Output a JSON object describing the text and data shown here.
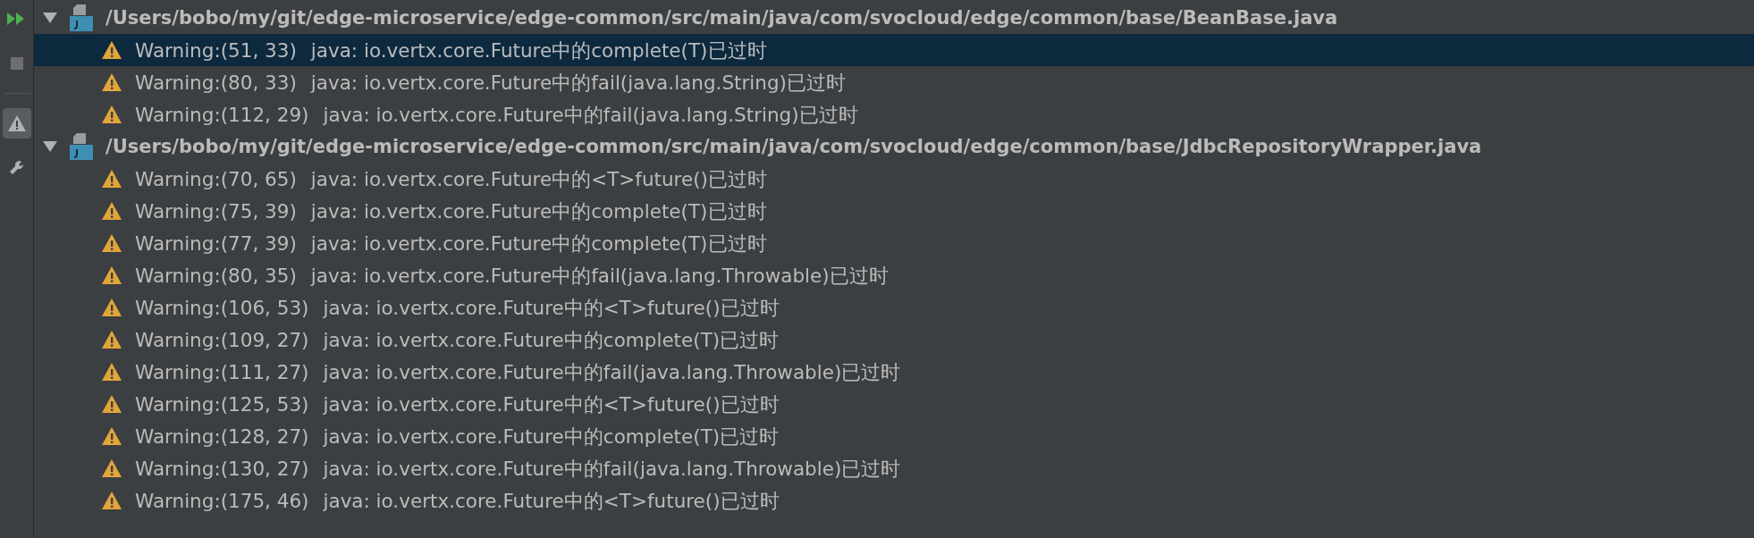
{
  "toolbar": [
    {
      "kind": "rerun",
      "selected": false
    },
    {
      "kind": "stop",
      "selected": false
    },
    {
      "kind": "warnings",
      "selected": true
    },
    {
      "kind": "settings",
      "selected": false
    }
  ],
  "files": [
    {
      "path": "/Users/bobo/my/git/edge-microservice/edge-common/src/main/java/com/svocloud/edge/common/base/BeanBase.java",
      "expanded": true,
      "warnings": [
        {
          "location": "Warning:(51, 33)",
          "message": "java: io.vertx.core.Future中的complete(T)已过时",
          "selected": true
        },
        {
          "location": "Warning:(80, 33)",
          "message": "java: io.vertx.core.Future中的fail(java.lang.String)已过时",
          "selected": false
        },
        {
          "location": "Warning:(112, 29)",
          "message": "java: io.vertx.core.Future中的fail(java.lang.String)已过时",
          "selected": false
        }
      ]
    },
    {
      "path": "/Users/bobo/my/git/edge-microservice/edge-common/src/main/java/com/svocloud/edge/common/base/JdbcRepositoryWrapper.java",
      "expanded": true,
      "warnings": [
        {
          "location": "Warning:(70, 65)",
          "message": "java: io.vertx.core.Future中的<T>future()已过时",
          "selected": false
        },
        {
          "location": "Warning:(75, 39)",
          "message": "java: io.vertx.core.Future中的complete(T)已过时",
          "selected": false
        },
        {
          "location": "Warning:(77, 39)",
          "message": "java: io.vertx.core.Future中的complete(T)已过时",
          "selected": false
        },
        {
          "location": "Warning:(80, 35)",
          "message": "java: io.vertx.core.Future中的fail(java.lang.Throwable)已过时",
          "selected": false
        },
        {
          "location": "Warning:(106, 53)",
          "message": "java: io.vertx.core.Future中的<T>future()已过时",
          "selected": false
        },
        {
          "location": "Warning:(109, 27)",
          "message": "java: io.vertx.core.Future中的complete(T)已过时",
          "selected": false
        },
        {
          "location": "Warning:(111, 27)",
          "message": "java: io.vertx.core.Future中的fail(java.lang.Throwable)已过时",
          "selected": false
        },
        {
          "location": "Warning:(125, 53)",
          "message": "java: io.vertx.core.Future中的<T>future()已过时",
          "selected": false
        },
        {
          "location": "Warning:(128, 27)",
          "message": "java: io.vertx.core.Future中的complete(T)已过时",
          "selected": false
        },
        {
          "location": "Warning:(130, 27)",
          "message": "java: io.vertx.core.Future中的fail(java.lang.Throwable)已过时",
          "selected": false
        },
        {
          "location": "Warning:(175, 46)",
          "message": "java: io.vertx.core.Future中的<T>future()已过时",
          "selected": false
        }
      ]
    }
  ]
}
